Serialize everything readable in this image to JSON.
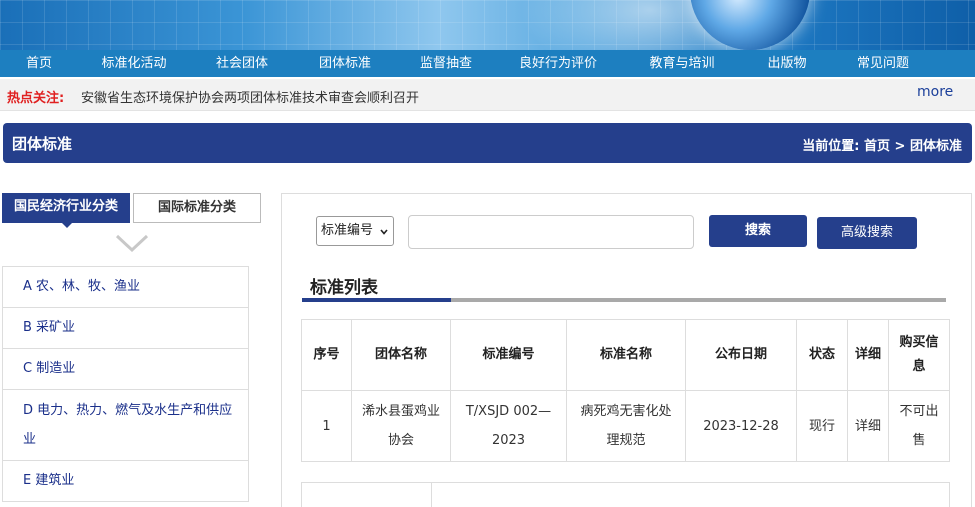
{
  "nav": {
    "items": [
      "首页",
      "标准化活动",
      "社会团体",
      "团体标准",
      "监督抽查",
      "良好行为评价",
      "教育与培训",
      "出版物",
      "常见问题"
    ]
  },
  "hot": {
    "label": "热点关注:",
    "text": "安徽省生态环境保护协会两项团体标准技术审查会顺利召开",
    "more": "more"
  },
  "section": {
    "title": "团体标准",
    "crumb_prefix": "当前位置:",
    "crumb_home": "首页",
    "crumb_sep": ">",
    "crumb_current": "团体标准"
  },
  "tabs": {
    "active": "国民经济行业分类",
    "inactive": "国际标准分类"
  },
  "categories": [
    "A 农、林、牧、渔业",
    "B 采矿业",
    "C 制造业",
    "D 电力、热力、燃气及水生产和供应业",
    "E 建筑业"
  ],
  "search": {
    "select_value": "标准编号",
    "input_value": "",
    "search_label": "搜索",
    "advanced_label": "高级搜索"
  },
  "list": {
    "title": "标准列表",
    "headers": [
      "序号",
      "团体名称",
      "标准编号",
      "标准名称",
      "公布日期",
      "状态",
      "详细",
      "购买信息"
    ],
    "rows": [
      {
        "no": "1",
        "org": "浠水县蛋鸡业协会",
        "code": "T/XSJD 002—2023",
        "name": "病死鸡无害化处理规范",
        "date": "2023-12-28",
        "status": "现行",
        "detail": "详细",
        "buy": "不可出售"
      }
    ]
  },
  "colors": {
    "primary": "#253f8c",
    "nav": "#1d7fc0",
    "hot_label": "#e02020",
    "link": "#1a2f8a"
  }
}
